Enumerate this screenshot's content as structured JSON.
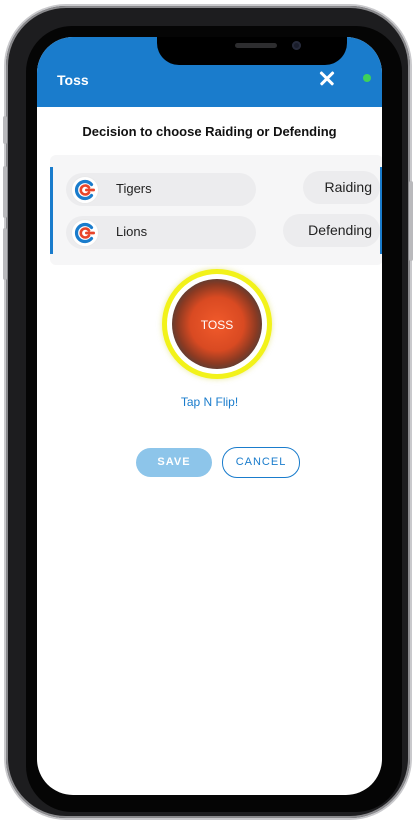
{
  "appbar": {
    "title": "Toss",
    "close_icon": "close-icon",
    "status_color": "#3ed15a"
  },
  "heading": "Decision to choose Raiding or Defending",
  "teams": [
    {
      "name": "Tigers",
      "role": "Raiding",
      "logo": "team-logo-icon"
    },
    {
      "name": "Lions",
      "role": "Defending",
      "logo": "team-logo-icon"
    }
  ],
  "toss": {
    "button_label": "TOSS",
    "hint": "Tap N Flip!"
  },
  "actions": {
    "save_label": "SAVE",
    "cancel_label": "CANCEL"
  },
  "colors": {
    "primary": "#1a7ccc",
    "accent_ring": "#f2f21a",
    "coin": "#f15a2b"
  }
}
